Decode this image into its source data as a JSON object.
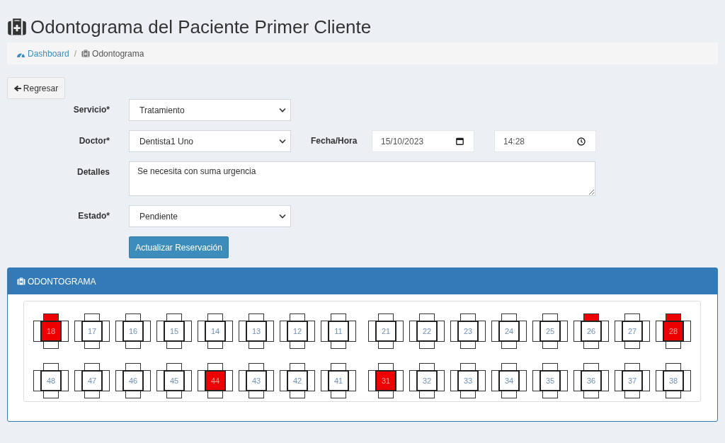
{
  "page": {
    "title": "Odontograma del Paciente Primer Cliente"
  },
  "breadcrumb": [
    {
      "label": "Dashboard",
      "kind": "link"
    },
    {
      "label": "/",
      "kind": "separator"
    },
    {
      "label": "Odontograma",
      "kind": "current"
    }
  ],
  "back_button": {
    "label": "Regresar"
  },
  "form": {
    "servicio": {
      "label": "Servicio*",
      "value": "Tratamiento"
    },
    "doctor": {
      "label": "Doctor*",
      "value": "Dentista1 Uno"
    },
    "fecha_hora": {
      "label": "Fecha/Hora",
      "date": "15/10/2023",
      "time": "14:28"
    },
    "detalles": {
      "label": "Detalles",
      "value": "Se necesita con suma urgencia"
    },
    "estado": {
      "label": "Estado*",
      "value": "Pendiente"
    },
    "submit": "Actualizar Reservación"
  },
  "odontograma": {
    "title": "ODONTOGRAMA",
    "rows": [
      {
        "groups": [
          [
            {
              "number": "18",
              "top": true,
              "left": false,
              "center": true,
              "right": false,
              "bottom": false
            },
            {
              "number": "17",
              "top": false,
              "left": false,
              "center": false,
              "right": false,
              "bottom": false
            },
            {
              "number": "16",
              "top": false,
              "left": false,
              "center": false,
              "right": false,
              "bottom": false
            },
            {
              "number": "15",
              "top": false,
              "left": false,
              "center": false,
              "right": false,
              "bottom": false
            },
            {
              "number": "14",
              "top": false,
              "left": false,
              "center": false,
              "right": false,
              "bottom": false
            },
            {
              "number": "13",
              "top": false,
              "left": false,
              "center": false,
              "right": false,
              "bottom": false
            },
            {
              "number": "12",
              "top": false,
              "left": false,
              "center": false,
              "right": false,
              "bottom": false
            },
            {
              "number": "11",
              "top": false,
              "left": false,
              "center": false,
              "right": false,
              "bottom": false
            }
          ],
          [
            {
              "number": "21",
              "top": false,
              "left": false,
              "center": false,
              "right": false,
              "bottom": false
            },
            {
              "number": "22",
              "top": false,
              "left": false,
              "center": false,
              "right": false,
              "bottom": false
            },
            {
              "number": "23",
              "top": false,
              "left": false,
              "center": false,
              "right": false,
              "bottom": false
            },
            {
              "number": "24",
              "top": false,
              "left": false,
              "center": false,
              "right": false,
              "bottom": false
            },
            {
              "number": "25",
              "top": false,
              "left": false,
              "center": false,
              "right": false,
              "bottom": false
            },
            {
              "number": "26",
              "top": true,
              "left": false,
              "center": false,
              "right": false,
              "bottom": false
            },
            {
              "number": "27",
              "top": false,
              "left": false,
              "center": false,
              "right": false,
              "bottom": false
            },
            {
              "number": "28",
              "top": true,
              "left": false,
              "center": true,
              "right": false,
              "bottom": false
            }
          ]
        ]
      },
      {
        "groups": [
          [
            {
              "number": "48",
              "top": false,
              "left": false,
              "center": false,
              "right": false,
              "bottom": false
            },
            {
              "number": "47",
              "top": false,
              "left": false,
              "center": false,
              "right": false,
              "bottom": false
            },
            {
              "number": "46",
              "top": false,
              "left": false,
              "center": false,
              "right": false,
              "bottom": false
            },
            {
              "number": "45",
              "top": false,
              "left": false,
              "center": false,
              "right": false,
              "bottom": false
            },
            {
              "number": "44",
              "top": false,
              "left": false,
              "center": true,
              "right": false,
              "bottom": false
            },
            {
              "number": "43",
              "top": false,
              "left": false,
              "center": false,
              "right": false,
              "bottom": false
            },
            {
              "number": "42",
              "top": false,
              "left": false,
              "center": false,
              "right": false,
              "bottom": false
            },
            {
              "number": "41",
              "top": false,
              "left": false,
              "center": false,
              "right": false,
              "bottom": false
            }
          ],
          [
            {
              "number": "31",
              "top": false,
              "left": false,
              "center": true,
              "right": false,
              "bottom": false
            },
            {
              "number": "32",
              "top": false,
              "left": false,
              "center": false,
              "right": false,
              "bottom": false
            },
            {
              "number": "33",
              "top": false,
              "left": false,
              "center": false,
              "right": false,
              "bottom": false
            },
            {
              "number": "34",
              "top": false,
              "left": false,
              "center": false,
              "right": false,
              "bottom": false
            },
            {
              "number": "35",
              "top": false,
              "left": false,
              "center": false,
              "right": false,
              "bottom": false
            },
            {
              "number": "36",
              "top": false,
              "left": false,
              "center": false,
              "right": false,
              "bottom": false
            },
            {
              "number": "37",
              "top": false,
              "left": false,
              "center": false,
              "right": false,
              "bottom": false
            },
            {
              "number": "38",
              "top": false,
              "left": false,
              "center": false,
              "right": false,
              "bottom": false
            }
          ]
        ]
      }
    ]
  }
}
